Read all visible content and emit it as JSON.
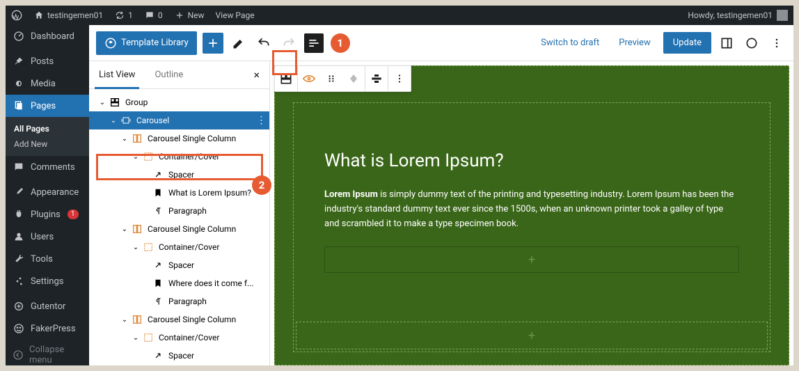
{
  "admin_bar": {
    "site": "testingemen01",
    "updates": "1",
    "comments": "0",
    "new": "New",
    "view_page": "View Page",
    "howdy": "Howdy, testingemen01"
  },
  "sidebar": {
    "dashboard": "Dashboard",
    "posts": "Posts",
    "media": "Media",
    "pages": "Pages",
    "all_pages": "All Pages",
    "add_new": "Add New",
    "comments": "Comments",
    "appearance": "Appearance",
    "plugins": "Plugins",
    "plugins_count": "1",
    "users": "Users",
    "tools": "Tools",
    "settings": "Settings",
    "gutentor": "Gutentor",
    "fakerpress": "FakerPress",
    "collapse": "Collapse menu"
  },
  "editor_header": {
    "template_library": "Template Library",
    "switch_draft": "Switch to draft",
    "preview": "Preview",
    "update": "Update"
  },
  "callouts": {
    "one": "1",
    "two": "2"
  },
  "list_panel": {
    "tab_list": "List View",
    "tab_outline": "Outline",
    "close": "×",
    "tree": {
      "group": "Group",
      "carousel": "Carousel",
      "csc1": "Carousel Single Column",
      "cc1": "Container/Cover",
      "spacer1": "Spacer",
      "what_is": "What is Lorem Ipsum?",
      "para1": "Paragraph",
      "csc2": "Carousel Single Column",
      "cc2": "Container/Cover",
      "spacer2": "Spacer",
      "where": "Where does it come f...",
      "para2": "Paragraph",
      "csc3": "Carousel Single Column",
      "cc3": "Container/Cover",
      "spacer3": "Spacer"
    }
  },
  "canvas": {
    "heading": "What is Lorem Ipsum?",
    "para_bold": "Lorem Ipsum",
    "para_rest": " is simply dummy text of the printing and typesetting industry. Lorem Ipsum has been the industry's standard dummy text ever since the 1500s, when an unknown printer took a galley of type and scrambled it to make a type specimen book."
  }
}
